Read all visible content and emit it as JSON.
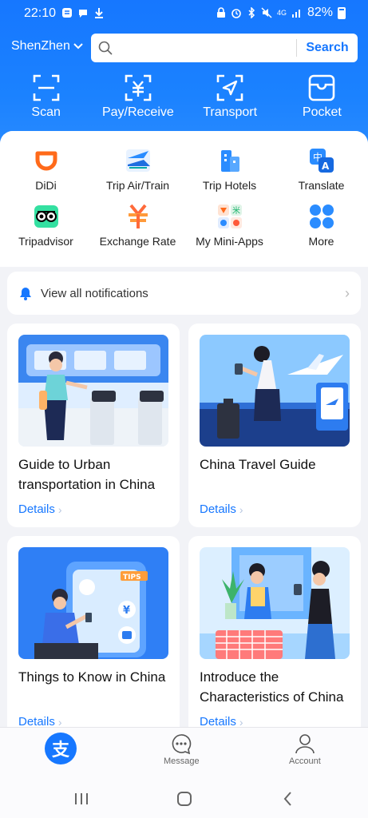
{
  "status_bar": {
    "time": "22:10",
    "battery": "82%",
    "network": "4G"
  },
  "header": {
    "city": "ShenZhen",
    "search": {
      "placeholder": "",
      "button_label": "Search"
    },
    "quick_actions": [
      {
        "label": "Scan",
        "icon": "scan-icon"
      },
      {
        "label": "Pay/Receive",
        "icon": "pay-icon"
      },
      {
        "label": "Transport",
        "icon": "transport-icon"
      },
      {
        "label": "Pocket",
        "icon": "pocket-icon"
      }
    ]
  },
  "services": [
    {
      "label": "DiDi",
      "icon": "didi-icon",
      "color": "#ff6a1a"
    },
    {
      "label": "Trip Air/Train",
      "icon": "plane-icon",
      "color": "#2a8cff"
    },
    {
      "label": "Trip Hotels",
      "icon": "hotel-icon",
      "color": "#2a8cff"
    },
    {
      "label": "Translate",
      "icon": "translate-icon",
      "color": "#2a8cff"
    },
    {
      "label": "Tripadvisor",
      "icon": "owl-icon",
      "color": "#34e0a1"
    },
    {
      "label": "Exchange Rate",
      "icon": "yuan-icon",
      "color": "#ff6a3a"
    },
    {
      "label": "My Mini-Apps",
      "icon": "mini-apps-icon",
      "color": "#ff8a3a"
    },
    {
      "label": "More",
      "icon": "more-icon",
      "color": "#2a8cff"
    }
  ],
  "notifications": {
    "label": "View all notifications"
  },
  "cards": [
    {
      "title": "Guide to Urban transportation in China",
      "link": "Details"
    },
    {
      "title": "China Travel Guide",
      "link": "Details"
    },
    {
      "title": "Things to Know in China",
      "link": "Details"
    },
    {
      "title": "Introduce the Characteristics of China",
      "link": "Details"
    }
  ],
  "bottom_nav": {
    "home_glyph": "支",
    "message_label": "Message",
    "account_label": "Account"
  },
  "colors": {
    "brand": "#1677ff",
    "background": "#f2f3f7"
  }
}
